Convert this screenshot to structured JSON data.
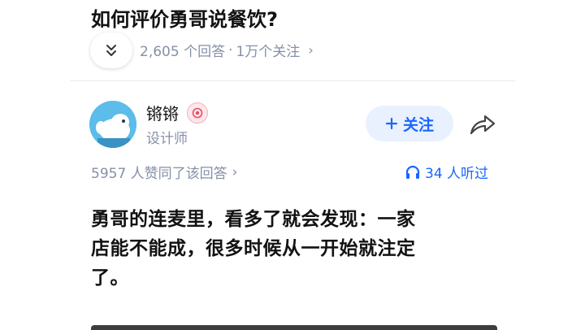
{
  "question": {
    "title": "如何评价勇哥说餐饮?",
    "answer_count": "2,605 个回答",
    "separator": "·",
    "follow_count": "1万个关注",
    "chevron": "›"
  },
  "author": {
    "name": "锵锵",
    "role": "设计师",
    "follow_label": "关注"
  },
  "stats": {
    "agree_text": "5957 人赞同了该回答",
    "agree_chevron": "›",
    "listened_text": "34 人听过"
  },
  "answer": {
    "lines": [
      "勇哥的连麦里，看多了就会发现：一家",
      "店能不能成，很多时候从一开始就注定",
      "了。"
    ]
  },
  "icons": {
    "collapse": "double-chevron-down-icon",
    "badge": "creator-badge-icon",
    "plus": "plus-icon",
    "share": "share-icon",
    "headphones": "headphones-icon"
  },
  "colors": {
    "accent": "#1a66ff",
    "secondary_text": "#8590a6",
    "follow_bg": "#e8f1fd",
    "avatar_bg": "#5cbcea"
  }
}
